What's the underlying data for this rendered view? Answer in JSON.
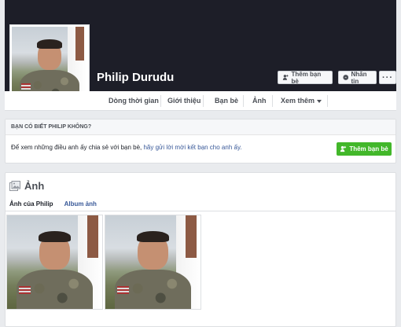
{
  "profile": {
    "name": "Philip Durudu"
  },
  "cover_actions": {
    "add_friend": "Thêm bạn bè",
    "message": "Nhắn tin",
    "more": "···"
  },
  "tabs": [
    {
      "label": "Dòng thời gian"
    },
    {
      "label": "Giới thiệu"
    },
    {
      "label": "Bạn bè"
    },
    {
      "label": "Ảnh"
    },
    {
      "label": "Xem thêm"
    }
  ],
  "know_card": {
    "header": "BẠN CÓ BIẾT PHILIP KHÔNG?",
    "text": "Để xem những điều anh ấy chia sẻ với bạn bè, ",
    "link": "hãy gửi lời mời kết bạn cho anh ấy.",
    "button": "Thêm bạn bè"
  },
  "photos": {
    "title": "Ảnh",
    "links": [
      "Ảnh của Philip",
      "Album ảnh"
    ]
  },
  "colors": {
    "cover": "#1d1e28",
    "green": "#42b72a",
    "link": "#385898"
  }
}
